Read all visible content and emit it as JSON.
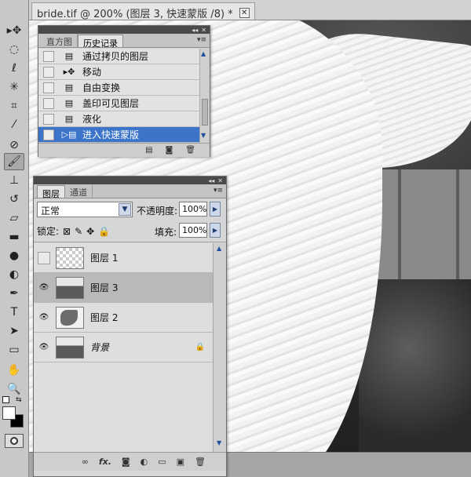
{
  "document": {
    "tab_title": "bride.tif @ 200% (图层 3, 快速蒙版 /8) *",
    "close_glyph": "✕"
  },
  "tools": [
    {
      "name": "move-tool",
      "glyph": "▸✥"
    },
    {
      "name": "marquee-tool",
      "glyph": "◌"
    },
    {
      "name": "lasso-tool",
      "glyph": "ℓ"
    },
    {
      "name": "magic-wand-tool",
      "glyph": "✳"
    },
    {
      "name": "crop-tool",
      "glyph": "⌗"
    },
    {
      "name": "eyedropper-tool",
      "glyph": "⁄"
    },
    {
      "name": "healing-tool",
      "glyph": "⊘"
    },
    {
      "name": "brush-tool",
      "glyph": "🖌"
    },
    {
      "name": "stamp-tool",
      "glyph": "⊥"
    },
    {
      "name": "history-brush-tool",
      "glyph": "↺"
    },
    {
      "name": "eraser-tool",
      "glyph": "▱"
    },
    {
      "name": "gradient-tool",
      "glyph": "▬"
    },
    {
      "name": "blur-tool",
      "glyph": "●"
    },
    {
      "name": "dodge-tool",
      "glyph": "◐"
    },
    {
      "name": "pen-tool",
      "glyph": "✒"
    },
    {
      "name": "type-tool",
      "glyph": "T"
    },
    {
      "name": "path-select-tool",
      "glyph": "➤"
    },
    {
      "name": "shape-tool",
      "glyph": "▭"
    },
    {
      "name": "hand-tool",
      "glyph": "✋"
    },
    {
      "name": "zoom-tool",
      "glyph": "🔍"
    }
  ],
  "colors": {
    "foreground": "#ffffff",
    "background": "#000000",
    "selection": "#3b74c9"
  },
  "history_panel": {
    "tabs": [
      "直方图",
      "历史记录"
    ],
    "items": [
      {
        "label": "通过拷贝的图层"
      },
      {
        "label": "移动"
      },
      {
        "label": "自由变换"
      },
      {
        "label": "盖印可见图层"
      },
      {
        "label": "液化"
      },
      {
        "label": "进入快速蒙版"
      }
    ],
    "footer_icons": [
      "new-document-icon",
      "camera-icon",
      "trash-icon"
    ]
  },
  "layers_panel": {
    "tabs": [
      "图层",
      "通道"
    ],
    "blend_mode": "正常",
    "opacity_label": "不透明度:",
    "opacity_value": "100%",
    "lock_label": "锁定:",
    "fill_label": "填充:",
    "fill_value": "100%",
    "layers": [
      {
        "name": "图层 1",
        "visible": false,
        "thumb": "transparent",
        "selected": false
      },
      {
        "name": "图层 3",
        "visible": true,
        "thumb": "photo",
        "selected": true
      },
      {
        "name": "图层 2",
        "visible": true,
        "thumb": "shape",
        "selected": false
      },
      {
        "name": "背景",
        "visible": true,
        "thumb": "photo",
        "selected": false,
        "locked": true
      }
    ],
    "footer_icons": [
      "link-icon",
      "fx-icon",
      "mask-icon",
      "adjustment-icon",
      "folder-icon",
      "new-layer-icon",
      "trash-icon"
    ]
  }
}
